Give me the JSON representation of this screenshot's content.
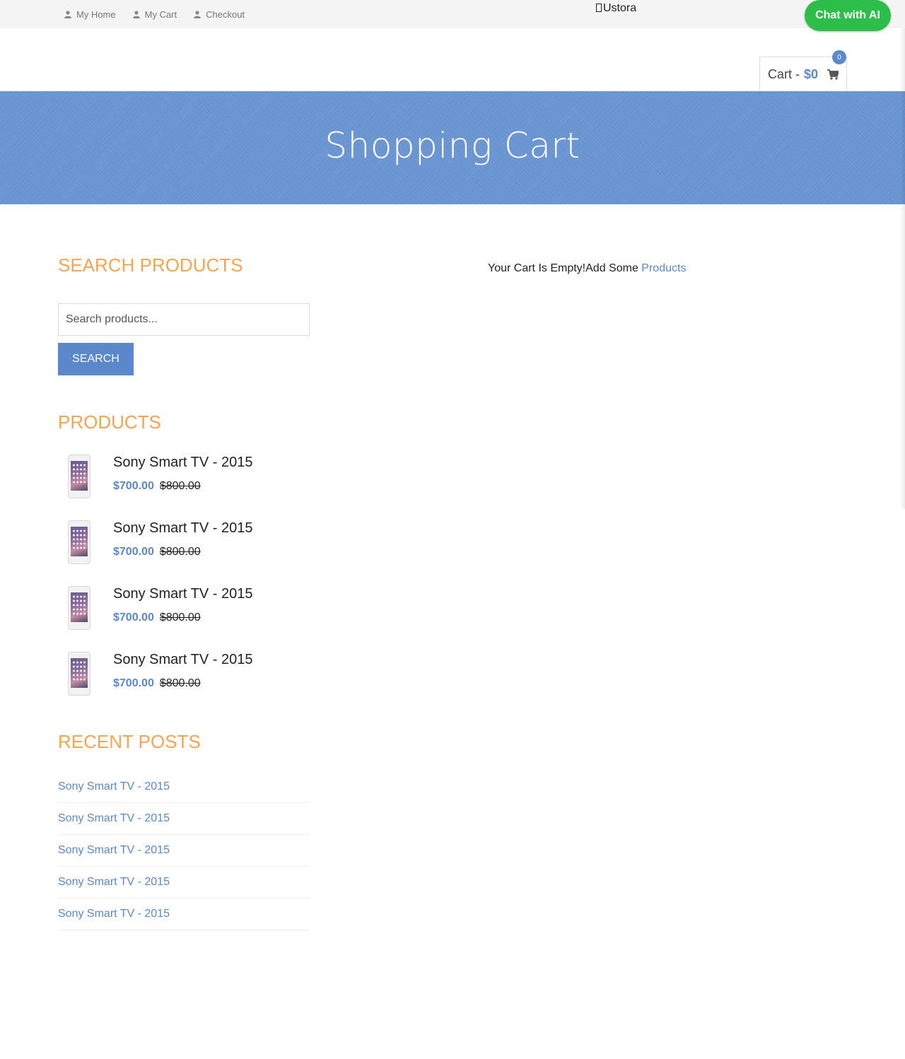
{
  "topbar": {
    "links": [
      {
        "label": "My Home",
        "icon": "user-icon"
      },
      {
        "label": "My Cart",
        "icon": "user-icon"
      },
      {
        "label": "Checkout",
        "icon": "user-icon"
      }
    ],
    "brand": "Ustora",
    "chat_button": "Chat with AI"
  },
  "cart": {
    "label": "Cart -",
    "amount": "$0",
    "count": "0",
    "icon": "shopping-cart-icon"
  },
  "banner": {
    "title": "Shopping Cart"
  },
  "sidebar": {
    "search": {
      "title": "SEARCH PRODUCTS",
      "placeholder": "Search products...",
      "button": "SEARCH"
    },
    "products": {
      "title": "PRODUCTS",
      "items": [
        {
          "name": "Sony Smart TV - 2015",
          "price": "$700.00",
          "old_price": "$800.00"
        },
        {
          "name": "Sony Smart TV - 2015",
          "price": "$700.00",
          "old_price": "$800.00"
        },
        {
          "name": "Sony Smart TV - 2015",
          "price": "$700.00",
          "old_price": "$800.00"
        },
        {
          "name": "Sony Smart TV - 2015",
          "price": "$700.00",
          "old_price": "$800.00"
        }
      ]
    },
    "recent_posts": {
      "title": "RECENT POSTS",
      "items": [
        "Sony Smart TV - 2015",
        "Sony Smart TV - 2015",
        "Sony Smart TV - 2015",
        "Sony Smart TV - 2015",
        "Sony Smart TV - 2015"
      ]
    }
  },
  "main": {
    "empty_text": "Your Cart Is Empty!Add Some",
    "empty_link": "Products"
  },
  "colors": {
    "accent": "#5a88ca",
    "heading": "#f5a450",
    "chat": "#2dbe4a",
    "banner": "#6b96d3"
  }
}
